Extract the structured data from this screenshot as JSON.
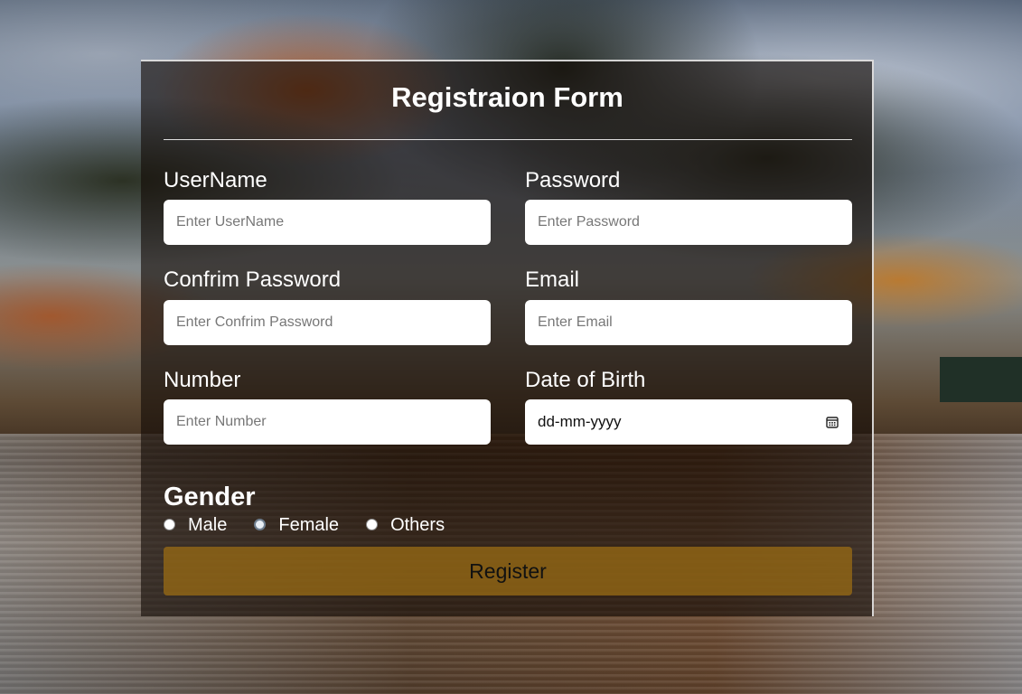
{
  "form": {
    "title": "Registraion Form",
    "fields": {
      "username": {
        "label": "UserName",
        "placeholder": "Enter UserName"
      },
      "password": {
        "label": "Password",
        "placeholder": "Enter Password"
      },
      "confirm_password": {
        "label": "Confrim Password",
        "placeholder": "Enter Confrim Password"
      },
      "email": {
        "label": "Email",
        "placeholder": "Enter Email"
      },
      "number": {
        "label": "Number",
        "placeholder": "Enter Number"
      },
      "dob": {
        "label": "Date of Birth",
        "value": "dd-mm-yyyy",
        "icon": "calendar-icon"
      }
    },
    "gender": {
      "title": "Gender",
      "options": [
        "Male",
        "Female",
        "Others"
      ]
    },
    "register_label": "Register"
  },
  "colors": {
    "card_overlay": "#140c06",
    "register_button": "#96691a",
    "text": "#ffffff"
  }
}
